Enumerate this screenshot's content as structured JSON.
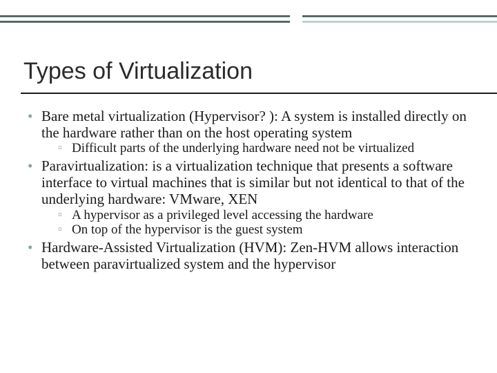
{
  "title": "Types of Virtualization",
  "bullets": {
    "b1": "Bare metal virtualization (Hypervisor? ): A system is installed directly on the hardware rather than on the host operating system",
    "b1_1": "Difficult parts of the underlying hardware need not be virtualized",
    "b2": "Paravirtualization: is a virtualization technique that presents a software interface to virtual machines that is similar but not identical to that of the underlying hardware: VMware, XEN",
    "b2_1": "A hypervisor as a privileged level accessing the hardware",
    "b2_2": "On top of the hypervisor is the guest system",
    "b3": "Hardware-Assisted Virtualization (HVM): Zen-HVM allows interaction between paravirtualized system and the hypervisor"
  }
}
